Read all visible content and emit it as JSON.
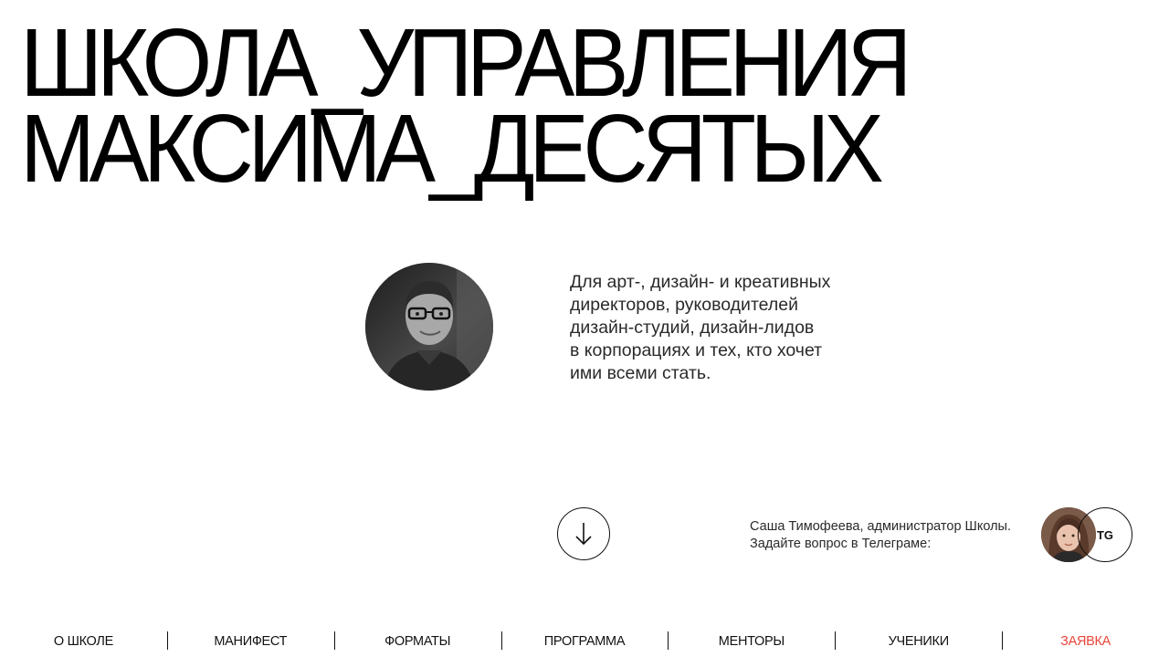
{
  "hero": {
    "title_line1": "ШКОЛА_УПРАВЛЕНИЯ",
    "title_line2": "МАКСИМА_ДЕСЯТЫХ"
  },
  "intro": {
    "tagline": "Для арт-, дизайн- и креативных\nдиректоров, руководителей\nдизайн-студий, дизайн-лидов\nв корпорациях и тех, кто хочет\nими всеми стать."
  },
  "contact": {
    "line1": "Саша Тимофеева, администратор Школы.",
    "line2": "Задайте вопрос в Телеграме:",
    "tg_label": "TG"
  },
  "icons": {
    "scroll": "arrow-down-icon"
  },
  "nav": {
    "items": [
      {
        "label": "О ШКОЛЕ"
      },
      {
        "label": "МАНИФЕСТ"
      },
      {
        "label": "ФОРМАТЫ"
      },
      {
        "label": "ПРОГРАММА"
      },
      {
        "label": "МЕНТОРЫ"
      },
      {
        "label": "УЧЕНИКИ"
      },
      {
        "label": "ЗАЯВКА"
      }
    ]
  },
  "colors": {
    "accent": "#e8463a",
    "text": "#111111",
    "background": "#ffffff"
  }
}
